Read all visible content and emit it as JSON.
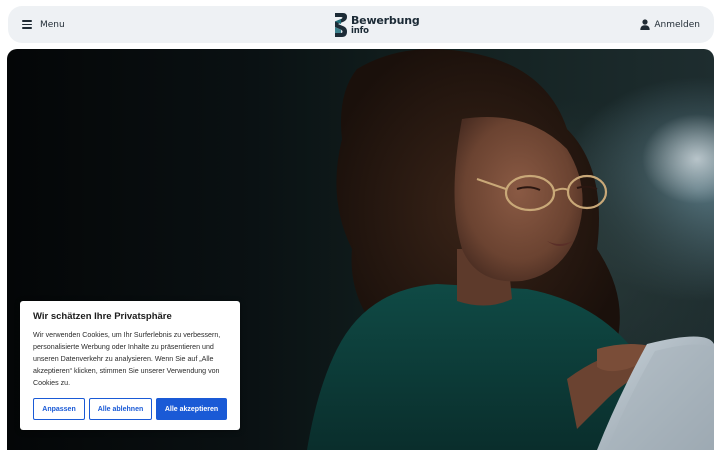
{
  "header": {
    "menu_label": "Menu",
    "logo_line1": "Bewerbung",
    "logo_line2": "info",
    "login_label": "Anmelden"
  },
  "hero": {
    "image_alt": ""
  },
  "cookie_banner": {
    "title": "Wir schätzen Ihre Privatsphäre",
    "text": "Wir verwenden Cookies, um Ihr Surferlebnis zu verbessern, personalisierte Werbung oder Inhalte zu präsentieren und unseren Datenverkehr zu analysieren. Wenn Sie auf „Alle akzeptieren“ klicken, stimmen Sie unserer Verwendung von Cookies zu.",
    "customize_label": "Anpassen",
    "reject_label": "Alle ablehnen",
    "accept_label": "Alle akzeptieren"
  },
  "colors": {
    "accent": "#1a5ad6",
    "header_bg": "#eef1f4",
    "logo_dark": "#1c2b36",
    "logo_teal": "#1f6f7a"
  },
  "icons": {
    "menu": "hamburger-icon",
    "user": "user-icon",
    "logo": "bewerbung-logo-mark"
  }
}
